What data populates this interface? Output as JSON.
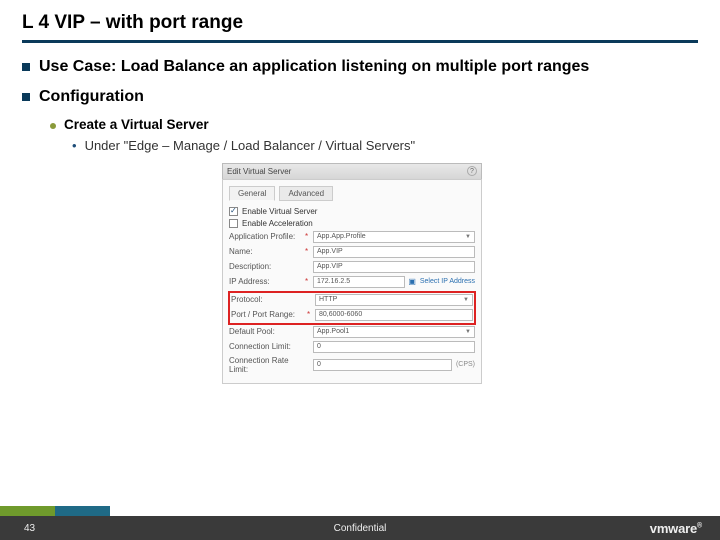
{
  "title": "L 4 VIP – with port range",
  "bullets": {
    "usecase": "Use Case: Load Balance an application listening on multiple port ranges",
    "config": "Configuration",
    "create": "Create a Virtual Server",
    "under": "Under \"Edge – Manage /  Load Balancer / Virtual Servers\""
  },
  "dialog": {
    "title": "Edit Virtual Server",
    "tabs": {
      "general": "General",
      "advanced": "Advanced"
    },
    "chk_enable_vs": "Enable Virtual Server",
    "chk_enable_acc": "Enable Acceleration",
    "labels": {
      "app_profile": "Application Profile:",
      "name": "Name:",
      "description": "Description:",
      "ip": "IP Address:",
      "protocol": "Protocol:",
      "port": "Port / Port Range:",
      "pool": "Default Pool:",
      "conn_limit": "Connection Limit:",
      "conn_rate": "Connection Rate Limit:"
    },
    "values": {
      "app_profile": "App.App.Profile",
      "name": "App.VIP",
      "description": "App.VIP",
      "ip": "172.16.2.5",
      "protocol": "HTTP",
      "port": "80,6000-6060",
      "pool": "App.Pool1",
      "conn_limit": "0",
      "conn_rate": "0"
    },
    "link_select_ip": "Select IP Address",
    "hint_cps": "(CPS)"
  },
  "footer": {
    "page": "43",
    "conf": "Confidential",
    "brand": "vmware"
  }
}
